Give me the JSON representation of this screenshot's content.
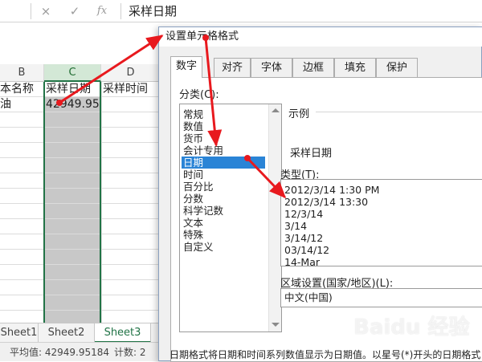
{
  "formula_bar": {
    "cancel_icon": "×",
    "confirm_icon": "✓",
    "fx_icon": "fx",
    "content": "采样日期"
  },
  "columns": {
    "b": "B",
    "c": "C",
    "d": "D"
  },
  "cells": {
    "b1": "本名称",
    "c1": "采样日期",
    "d1": "采样时间",
    "b2": "油",
    "c2": "42949.95"
  },
  "sheet_tabs": [
    "Sheet1",
    "Sheet2",
    "Sheet3"
  ],
  "status": {
    "average": "平均值: 42949.95184",
    "count": "计数: 2"
  },
  "dialog": {
    "title": "设置单元格格式",
    "tabs": [
      "数字",
      "对齐",
      "字体",
      "边框",
      "填充",
      "保护"
    ],
    "active_tab": "数字",
    "category_label": "分类(C):",
    "categories": [
      "常规",
      "数值",
      "货币",
      "会计专用",
      "日期",
      "时间",
      "百分比",
      "分数",
      "科学记数",
      "文本",
      "特殊",
      "自定义"
    ],
    "selected_category": "日期",
    "sample_label": "示例",
    "sample_value": "采样日期",
    "type_label": "类型(T):",
    "types": [
      "2012/3/14 1:30 PM",
      "2012/3/14 13:30",
      "12/3/14",
      "3/14",
      "3/14/12",
      "03/14/12",
      "14-Mar"
    ],
    "locale_label": "区域设置(国家/地区)(L):",
    "locale_value": "中文(中国)",
    "description": "日期格式将日期和时间系列数值显示为日期值。以星号(*)开头的日期格式"
  },
  "watermark": "Baidu 经验",
  "colors": {
    "excel_green": "#217346",
    "selection_blue": "#2a84d6",
    "arrow_red": "#e8191e"
  }
}
